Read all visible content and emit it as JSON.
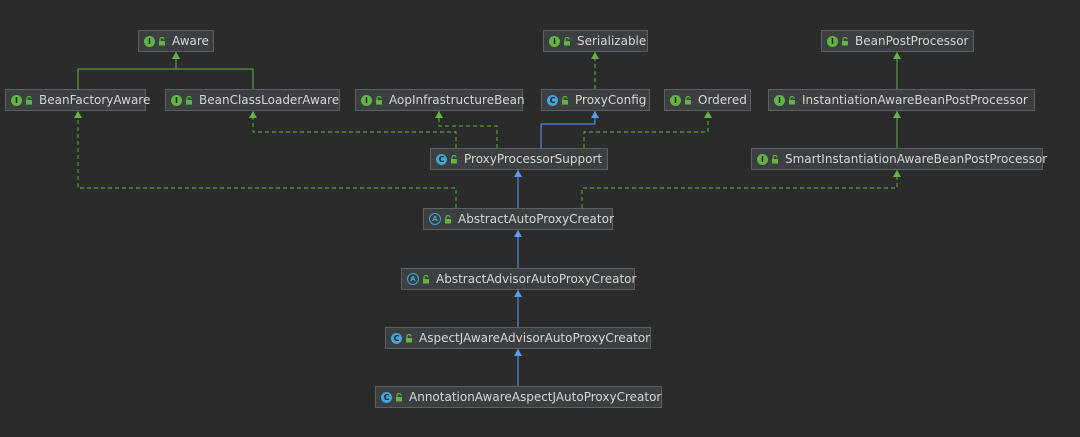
{
  "colors": {
    "background": "#2b2b2b",
    "node_fill": "#3c3f41",
    "node_border": "#5e6060",
    "text": "#d6d6d6",
    "interface_icon": "#62b543",
    "class_icon": "#40a5d8",
    "implements_edge": "#62b543",
    "extends_edge": "#589df6"
  },
  "nodes": [
    {
      "id": "aware",
      "label": "Aware",
      "kind": "interface",
      "kind_letter": "I",
      "icon": "interface-icon"
    },
    {
      "id": "bean-factory-aware",
      "label": "BeanFactoryAware",
      "kind": "interface",
      "kind_letter": "I",
      "icon": "interface-icon"
    },
    {
      "id": "bean-class-loader-aware",
      "label": "BeanClassLoaderAware",
      "kind": "interface",
      "kind_letter": "I",
      "icon": "interface-icon"
    },
    {
      "id": "aop-infrastructure-bean",
      "label": "AopInfrastructureBean",
      "kind": "interface",
      "kind_letter": "I",
      "icon": "interface-icon"
    },
    {
      "id": "serializable",
      "label": "Serializable",
      "kind": "interface",
      "kind_letter": "I",
      "icon": "interface-icon"
    },
    {
      "id": "proxy-config",
      "label": "ProxyConfig",
      "kind": "class",
      "kind_letter": "C",
      "icon": "class-icon"
    },
    {
      "id": "ordered",
      "label": "Ordered",
      "kind": "interface",
      "kind_letter": "I",
      "icon": "interface-icon"
    },
    {
      "id": "bean-post-processor",
      "label": "BeanPostProcessor",
      "kind": "interface",
      "kind_letter": "I",
      "icon": "interface-icon"
    },
    {
      "id": "instantiation-aware-bean-post-processor",
      "label": "InstantiationAwareBeanPostProcessor",
      "kind": "interface",
      "kind_letter": "I",
      "icon": "interface-icon"
    },
    {
      "id": "proxy-processor-support",
      "label": "ProxyProcessorSupport",
      "kind": "class",
      "kind_letter": "C",
      "icon": "class-icon"
    },
    {
      "id": "smart-instantiation-aware-bean-post-processor",
      "label": "SmartInstantiationAwareBeanPostProcessor",
      "kind": "interface",
      "kind_letter": "I",
      "icon": "interface-icon"
    },
    {
      "id": "abstract-auto-proxy-creator",
      "label": "AbstractAutoProxyCreator",
      "kind": "abstract",
      "kind_letter": "A",
      "icon": "abstract-class-icon"
    },
    {
      "id": "abstract-advisor-auto-proxy-creator",
      "label": "AbstractAdvisorAutoProxyCreator",
      "kind": "abstract",
      "kind_letter": "A",
      "icon": "abstract-class-icon"
    },
    {
      "id": "aspectj-aware-advisor-auto-proxy-creator",
      "label": "AspectJAwareAdvisorAutoProxyCreator",
      "kind": "class",
      "kind_letter": "C",
      "icon": "class-icon"
    },
    {
      "id": "annotation-aware-aspectj-auto-proxy-creator",
      "label": "AnnotationAwareAspectJAutoProxyCreator",
      "kind": "class",
      "kind_letter": "C",
      "icon": "class-icon"
    }
  ],
  "edges": [
    {
      "from": "bean-factory-aware",
      "to": "aware",
      "relation": "extends-interface"
    },
    {
      "from": "bean-class-loader-aware",
      "to": "aware",
      "relation": "extends-interface"
    },
    {
      "from": "proxy-config",
      "to": "serializable",
      "relation": "implements"
    },
    {
      "from": "instantiation-aware-bean-post-processor",
      "to": "bean-post-processor",
      "relation": "extends-interface"
    },
    {
      "from": "smart-instantiation-aware-bean-post-processor",
      "to": "instantiation-aware-bean-post-processor",
      "relation": "extends-interface"
    },
    {
      "from": "proxy-processor-support",
      "to": "proxy-config",
      "relation": "extends"
    },
    {
      "from": "proxy-processor-support",
      "to": "bean-class-loader-aware",
      "relation": "implements"
    },
    {
      "from": "proxy-processor-support",
      "to": "aop-infrastructure-bean",
      "relation": "implements"
    },
    {
      "from": "proxy-processor-support",
      "to": "ordered",
      "relation": "implements"
    },
    {
      "from": "abstract-auto-proxy-creator",
      "to": "proxy-processor-support",
      "relation": "extends"
    },
    {
      "from": "abstract-auto-proxy-creator",
      "to": "bean-factory-aware",
      "relation": "implements"
    },
    {
      "from": "abstract-auto-proxy-creator",
      "to": "smart-instantiation-aware-bean-post-processor",
      "relation": "implements"
    },
    {
      "from": "abstract-advisor-auto-proxy-creator",
      "to": "abstract-auto-proxy-creator",
      "relation": "extends"
    },
    {
      "from": "aspectj-aware-advisor-auto-proxy-creator",
      "to": "abstract-advisor-auto-proxy-creator",
      "relation": "extends"
    },
    {
      "from": "annotation-aware-aspectj-auto-proxy-creator",
      "to": "aspectj-aware-advisor-auto-proxy-creator",
      "relation": "extends"
    }
  ]
}
